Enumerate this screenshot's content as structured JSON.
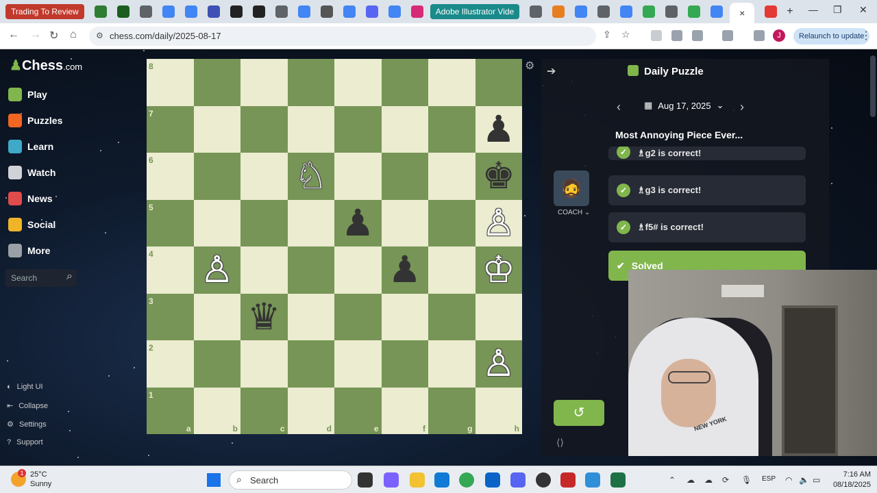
{
  "browser": {
    "first_tab_label": "Trading To Review",
    "named_tab_label": "Adobe Illustrator Vide",
    "active_tab_close": "×",
    "new_tab": "+",
    "url": "chess.com/daily/2025-08-17",
    "relaunch_label": "Relaunch to update",
    "profile_initial": "J"
  },
  "sidebar": {
    "logo_text": "Chess",
    "logo_suffix": ".com",
    "items": [
      {
        "label": "Play",
        "color": "#81b64c"
      },
      {
        "label": "Puzzles",
        "color": "#f26522"
      },
      {
        "label": "Learn",
        "color": "#3fa9c8"
      },
      {
        "label": "Watch",
        "color": "#cfd2d6"
      },
      {
        "label": "News",
        "color": "#e04b4b"
      },
      {
        "label": "Social",
        "color": "#f0b429"
      },
      {
        "label": "More",
        "color": "#9aa0a6"
      }
    ],
    "search_placeholder": "Search",
    "footer": [
      {
        "label": "Light UI",
        "icon": "half-moon-icon"
      },
      {
        "label": "Collapse",
        "icon": "collapse-icon"
      },
      {
        "label": "Settings",
        "icon": "gear-icon"
      },
      {
        "label": "Support",
        "icon": "help-icon"
      }
    ]
  },
  "board": {
    "ranks": [
      "8",
      "7",
      "6",
      "5",
      "4",
      "3",
      "2",
      "1"
    ],
    "files": [
      "a",
      "b",
      "c",
      "d",
      "e",
      "f",
      "g",
      "h"
    ],
    "colors": {
      "light": "#ebecd0",
      "dark": "#779556"
    },
    "pieces": [
      {
        "square": "h7",
        "glyph": "♟",
        "side": "b"
      },
      {
        "square": "h6",
        "glyph": "♚",
        "side": "b"
      },
      {
        "square": "d6",
        "glyph": "♘",
        "side": "w"
      },
      {
        "square": "e5",
        "glyph": "♟",
        "side": "b"
      },
      {
        "square": "h5",
        "glyph": "♙",
        "side": "w"
      },
      {
        "square": "b4",
        "glyph": "♙",
        "side": "w"
      },
      {
        "square": "f4",
        "glyph": "♟",
        "side": "b"
      },
      {
        "square": "h4",
        "glyph": "♔",
        "side": "w"
      },
      {
        "square": "c3",
        "glyph": "♛",
        "side": "b"
      },
      {
        "square": "h2",
        "glyph": "♙",
        "side": "w"
      }
    ]
  },
  "panel": {
    "title": "Daily Puzzle",
    "date": "Aug 17, 2025",
    "puzzle_name": "Most Annoying Piece Ever...",
    "coach_label": "COACH",
    "moves": [
      "♗g2 is correct!",
      "♗g3 is correct!",
      "♗f5# is correct!"
    ],
    "solved_label": "Solved",
    "accent": "#81b64c"
  },
  "webcam": {
    "shirt_text": "NEW YORK"
  },
  "taskbar": {
    "temp": "25°C",
    "condition": "Sunny",
    "weather_badge": "1",
    "search_label": "Search",
    "language": "ESP",
    "time": "7:16 AM",
    "date": "08/18/2025"
  }
}
